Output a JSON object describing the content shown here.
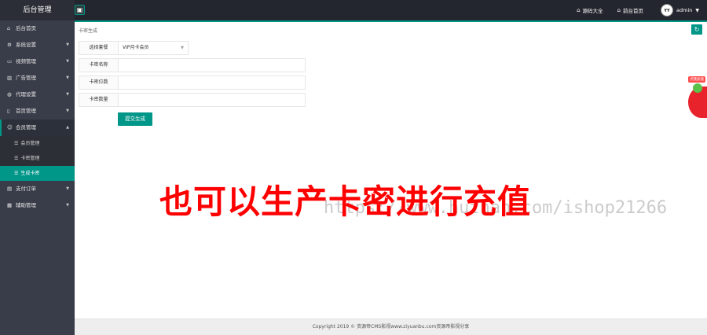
{
  "header": {
    "brand": "后台管理",
    "toggle_icon": "▣",
    "links": [
      {
        "icon": "⌂",
        "label": "源码大全"
      },
      {
        "icon": "⌂",
        "label": "前台首页"
      }
    ],
    "avatar_text": "YY",
    "user": "admin"
  },
  "sidebar": {
    "items": [
      {
        "icon": "⌂",
        "label": "后台首页",
        "arrow": ""
      },
      {
        "icon": "⚙",
        "label": "系统设置",
        "arrow": "▼"
      },
      {
        "icon": "▭",
        "label": "视频管理",
        "arrow": "▼"
      },
      {
        "icon": "▥",
        "label": "广告管理",
        "arrow": "▼"
      },
      {
        "icon": "◍",
        "label": "代理设置",
        "arrow": "▼"
      },
      {
        "icon": "▯",
        "label": "首页管理",
        "arrow": "▼"
      },
      {
        "icon": "☺",
        "label": "会员管理",
        "arrow": "▲"
      }
    ],
    "sub_items": [
      {
        "label": "会员管理"
      },
      {
        "label": "卡密管理"
      },
      {
        "label": "生成卡密"
      }
    ],
    "bottom_items": [
      {
        "icon": "▤",
        "label": "支付订单",
        "arrow": "▼"
      },
      {
        "icon": "▦",
        "label": "辅助管理",
        "arrow": "▼"
      }
    ]
  },
  "content": {
    "breadcrumb": "卡密生成",
    "refresh_icon": "↻",
    "form": {
      "type_label": "选择套餐",
      "type_value": "VIP月卡会员",
      "name_label": "卡密名称",
      "digits_label": "卡密位数",
      "count_label": "卡密数量",
      "submit_label": "提交生成"
    }
  },
  "overlay": {
    "banner": "也可以生产卡密进行充值",
    "watermark": "https://www.huzhan.com/ishop21266"
  },
  "float": {
    "tag": "点我加速"
  },
  "footer": {
    "copyright": "Copyright 2019 © 资源帝CMS影视www.ziyuanbu.com资源帝影视分享"
  },
  "colors": {
    "accent": "#009688",
    "sidebar": "#393d49",
    "header": "#23262e",
    "banner": "#ff0000"
  }
}
